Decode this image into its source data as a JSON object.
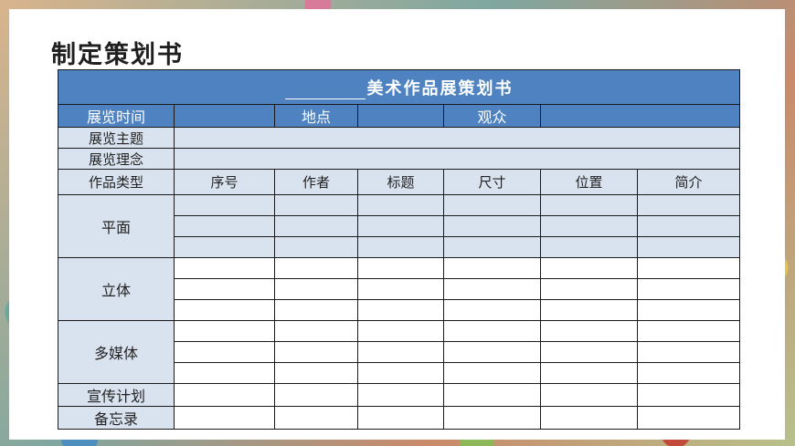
{
  "page_title": "制定策划书",
  "table": {
    "title": "美术作品展策划书",
    "info_row": {
      "time_label": "展览时间",
      "place_label": "地点",
      "audience_label": "观众"
    },
    "theme_label": "展览主题",
    "concept_label": "展览理念",
    "columns": [
      "作品类型",
      "序号",
      "作者",
      "标题",
      "尺寸",
      "位置",
      "简介"
    ],
    "categories": [
      "平面",
      "立体",
      "多媒体"
    ],
    "footer_rows": [
      "宣传计划",
      "备忘录"
    ]
  },
  "colors": {
    "header_blue": "#4e82c0",
    "light_blue": "#d9e3f0"
  }
}
